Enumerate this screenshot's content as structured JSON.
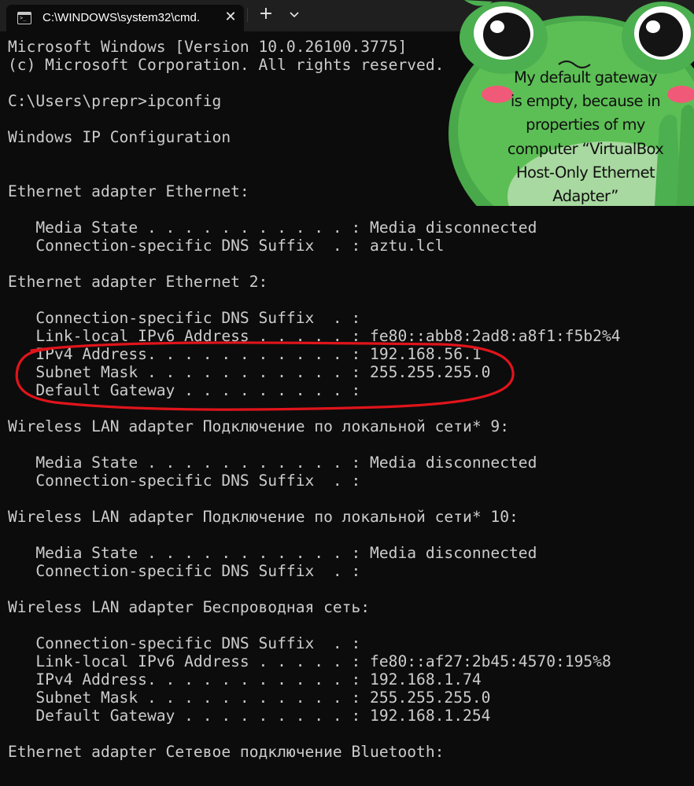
{
  "window": {
    "tab_title": "C:\\WINDOWS\\system32\\cmd.",
    "tab_icon_glyph": ">_",
    "close_glyph": "✕",
    "new_tab_glyph": "+"
  },
  "console": {
    "lines": [
      "Microsoft Windows [Version 10.0.26100.3775]",
      "(c) Microsoft Corporation. All rights reserved.",
      "",
      "C:\\Users\\prepr>ipconfig",
      "",
      "Windows IP Configuration",
      "",
      "",
      "Ethernet adapter Ethernet:",
      "",
      "   Media State . . . . . . . . . . . : Media disconnected",
      "   Connection-specific DNS Suffix  . : aztu.lcl",
      "",
      "Ethernet adapter Ethernet 2:",
      "",
      "   Connection-specific DNS Suffix  . :",
      "   Link-local IPv6 Address . . . . . : fe80::abb8:2ad8:a8f1:f5b2%4",
      "   IPv4 Address. . . . . . . . . . . : 192.168.56.1",
      "   Subnet Mask . . . . . . . . . . . : 255.255.255.0",
      "   Default Gateway . . . . . . . . . :",
      "",
      "Wireless LAN adapter Подключение по локальной сети* 9:",
      "",
      "   Media State . . . . . . . . . . . : Media disconnected",
      "   Connection-specific DNS Suffix  . :",
      "",
      "Wireless LAN adapter Подключение по локальной сети* 10:",
      "",
      "   Media State . . . . . . . . . . . : Media disconnected",
      "   Connection-specific DNS Suffix  . :",
      "",
      "Wireless LAN adapter Беспроводная сеть:",
      "",
      "   Connection-specific DNS Suffix  . :",
      "   Link-local IPv6 Address . . . . . : fe80::af27:2b45:4570:195%8",
      "   IPv4 Address. . . . . . . . . . . : 192.168.1.74",
      "   Subnet Mask . . . . . . . . . . . : 255.255.255.0",
      "   Default Gateway . . . . . . . . . : 192.168.1.254",
      "",
      "Ethernet adapter Сетевое подключение Bluetooth:"
    ]
  },
  "sticker": {
    "text_lines": [
      "My default gateway",
      "is empty, because in",
      "properties of my",
      "computer “VirtualBox",
      "Host-Only Ethernet",
      "Adapter”"
    ]
  },
  "colors": {
    "console_bg": "#0c0c0c",
    "console_text": "#cccccc",
    "titlebar_bg": "#1f1f1f",
    "annotation_red": "#e0141b",
    "frog_green": "#4caf50"
  }
}
